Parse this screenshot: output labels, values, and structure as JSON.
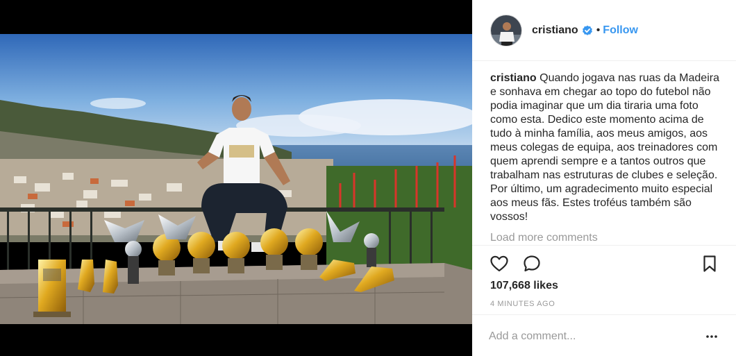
{
  "post": {
    "username": "cristiano",
    "follow_label": "Follow",
    "separator": "•",
    "caption_user": "cristiano",
    "caption_text": "Quando jogava nas ruas da Madeira e sonhava em chegar ao topo do futebol não podia imaginar que um dia tiraria uma foto como esta. Dedico este momento acima de tudo à minha família, aos meus amigos, aos meus colegas de equipa, aos treinadores com quem aprendi sempre e a tantos outros que trabalham nas estruturas de clubes e seleção. Por último, um agradecimento muito especial aos meus fãs. Estes troféus também são vossos!",
    "load_more": "Load more comments",
    "likes": "107,668 likes",
    "time": "4 MINUTES AGO"
  },
  "comment": {
    "placeholder": "Add a comment..."
  },
  "icons": {
    "verified": "verified-badge-icon",
    "like": "heart-icon",
    "comment": "speech-bubble-icon",
    "save": "bookmark-icon",
    "more": "ellipsis-icon"
  },
  "colors": {
    "accent": "#3897f0",
    "text": "#262626",
    "muted": "#999999",
    "divider": "#efefef"
  }
}
